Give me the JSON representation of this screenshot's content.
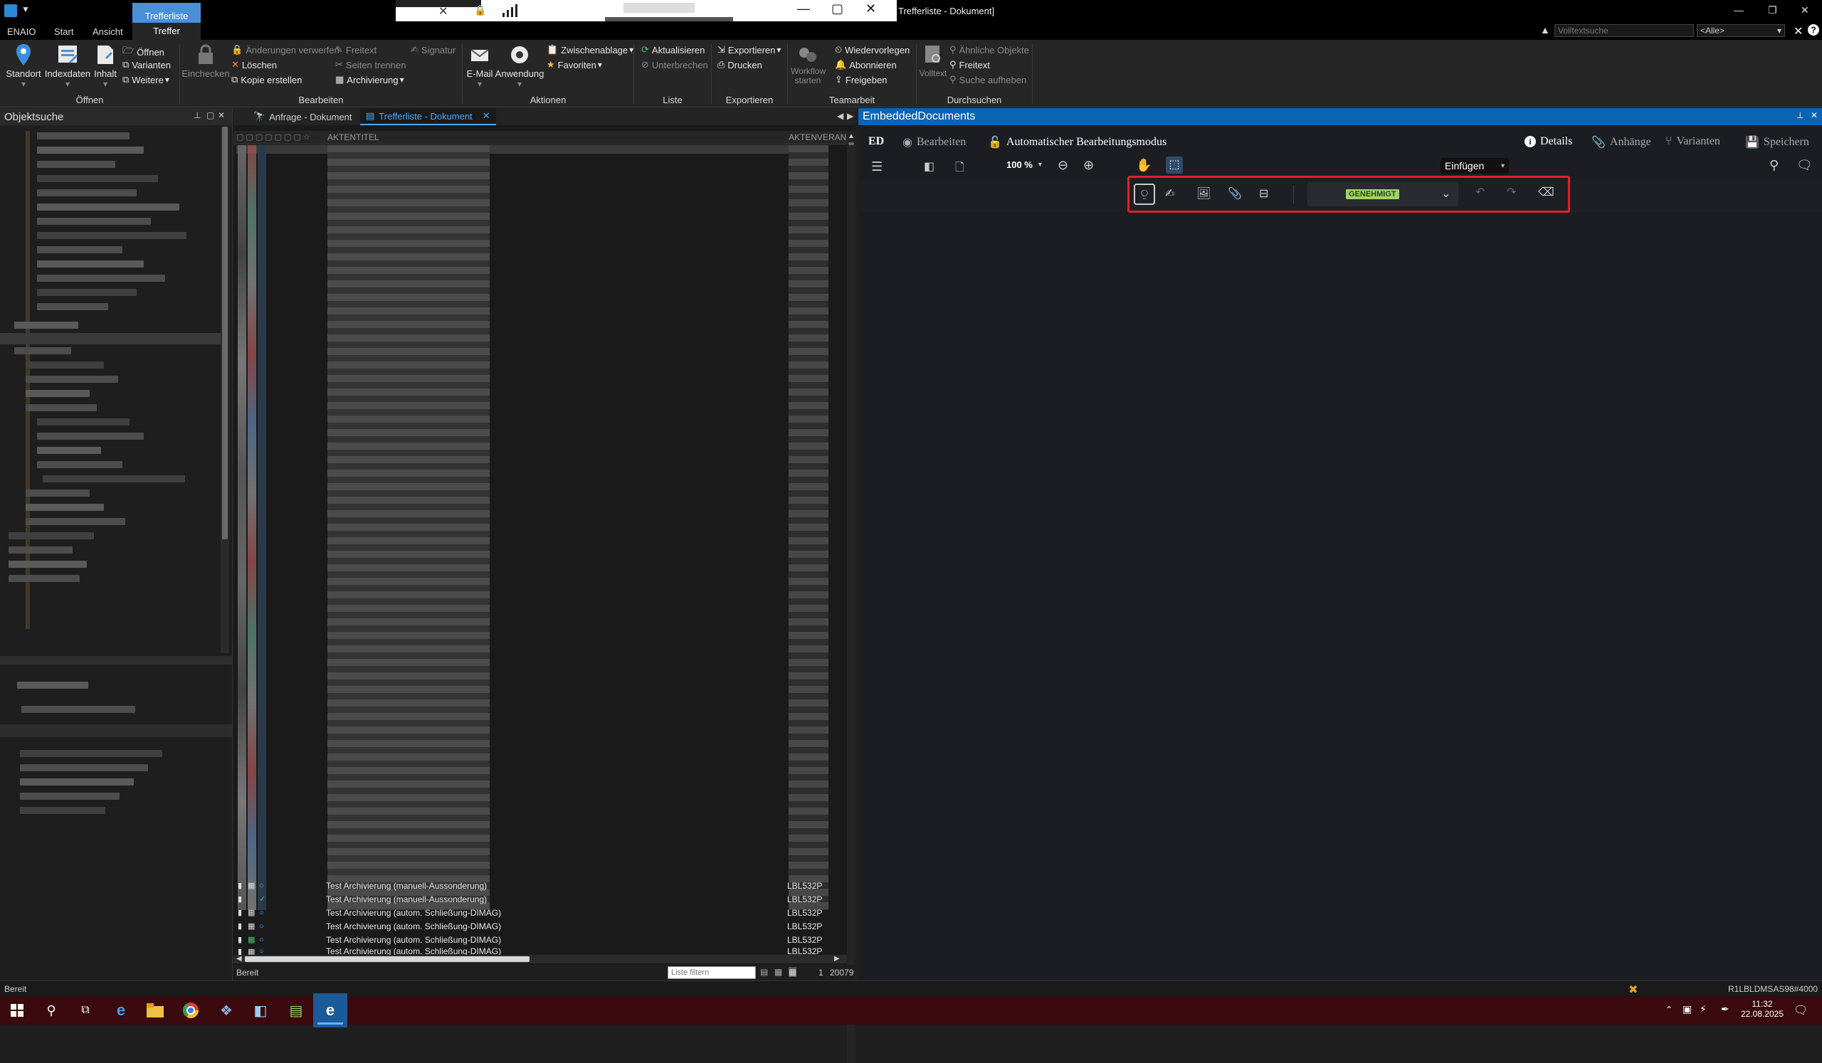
{
  "window": {
    "title": "Trefferliste - Dokument]",
    "controls": [
      "—",
      "▢",
      "✕"
    ]
  },
  "menu_tabs": [
    {
      "label": "ENAIO"
    },
    {
      "label": "Start"
    },
    {
      "label": "Ansicht"
    },
    {
      "label": "Treffer",
      "context": "Trefferliste"
    }
  ],
  "top_right": {
    "search_placeholder": "Volltextsuche",
    "scope_value": "<Alle>"
  },
  "ribbon": {
    "oeffnen": {
      "label": "Öffnen",
      "standort": "Standort",
      "indexdaten": "Indexdaten",
      "inhalt": "Inhalt",
      "oeffnen": "Öffnen",
      "varianten": "Varianten",
      "weitere": "Weitere"
    },
    "bearbeiten": {
      "label": "Bearbeiten",
      "einchecken": "Einchecken",
      "aenderungen": "Änderungen verwerfen",
      "loeschen": "Löschen",
      "kopie": "Kopie erstellen",
      "freitext": "Freitext",
      "seiten": "Seiten trennen",
      "archivierung": "Archivierung",
      "signatur": "Signatur"
    },
    "aktionen": {
      "label": "Aktionen",
      "email": "E-Mail",
      "anwendung": "Anwendung",
      "zwischenablage": "Zwischenablage",
      "favoriten": "Favoriten"
    },
    "liste": {
      "label": "Liste",
      "aktualisieren": "Aktualisieren",
      "unterbrechen": "Unterbrechen"
    },
    "exportieren": {
      "label": "Exportieren",
      "exportieren": "Exportieren",
      "drucken": "Drucken"
    },
    "teamarbeit": {
      "label": "Teamarbeit",
      "workflow": "Workflow starten",
      "wiedervorlegen": "Wiedervorlegen",
      "abonnieren": "Abonnieren",
      "freigeben": "Freigeben"
    },
    "durchsuchen": {
      "label": "Durchsuchen",
      "volltext": "Volltext",
      "aehnliche": "Ähnliche Objekte",
      "freitext": "Freitext",
      "suche_aufheben": "Suche aufheben"
    }
  },
  "left_panel": {
    "title": "Objektsuche"
  },
  "doc_tabs": [
    {
      "label": "Anfrage - Dokument",
      "active": false
    },
    {
      "label": "Trefferliste - Dokument",
      "active": true
    }
  ],
  "result_list": {
    "col_title": "AKTENTITEL",
    "col_ref": "AKTENVERAN",
    "rows": [
      {
        "title": "Test Archivierung (manuell-Aussonderung)",
        "ref": "LBL532P"
      },
      {
        "title": "Test Archivierung (manuell-Aussonderung)",
        "ref": "LBL532P"
      },
      {
        "title": "Test Archivierung (autom. Schließung-DIMAG)",
        "ref": "LBL532P"
      },
      {
        "title": "Test Archivierung (autom. Schließung-DIMAG)",
        "ref": "LBL532P"
      },
      {
        "title": "Test Archivierung (autom. Schließung-DIMAG)",
        "ref": "LBL532P"
      },
      {
        "title": "Test Archivierung (autom. Schließung-DIMAG)",
        "ref": "LBL532P"
      }
    ],
    "filter_placeholder": "Liste filtern",
    "page": "1",
    "count": "20079"
  },
  "embedded": {
    "panel_title": "EmbeddedDocuments",
    "logo": "ED",
    "bearbeiten": "Bearbeiten",
    "auto_mode": "Automatischer Bearbeitungsmodus",
    "details": "Details",
    "anhaenge": "Anhänge",
    "varianten": "Varianten",
    "speichern": "Speichern",
    "zoom": "100 %",
    "insert_mode": "Einfügen",
    "stamp_value": "GENEHMIGT"
  },
  "status": {
    "left": "Bereit",
    "right": "R1LBLDMSAS98#4000"
  },
  "taskbar": {
    "time": "11:32",
    "date": "22.08.2025"
  },
  "colors": {
    "accent": "#1e78c8",
    "panel_header": "#0a64b4",
    "highlight_border": "#e0202a",
    "stamp_green": "#9fd36a"
  }
}
